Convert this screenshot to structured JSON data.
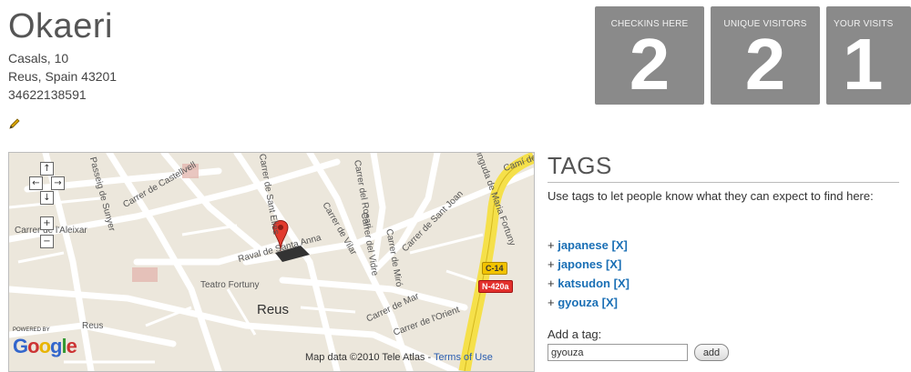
{
  "venue": {
    "name": "Okaeri",
    "address_line1": "Casals, 10",
    "address_line2": "Reus, Spain 43201",
    "phone": "34622138591"
  },
  "stats": [
    {
      "label": "CHECKINS HERE",
      "value": "2"
    },
    {
      "label": "UNIQUE VISITORS",
      "value": "2"
    },
    {
      "label": "YOUR VISITS",
      "value": "1"
    }
  ],
  "map": {
    "city_label": "Reus",
    "street_labels": [
      "Carrer de l'Aleixar",
      "Passeig de Sunyer",
      "Carrer de Castellvell",
      "Carrer del Rosari",
      "Carrer de Sant Elies",
      "Carrer de Sant Joan",
      "Raval de Santa Anna",
      "Carrer de Vilar",
      "Carrer del Vidre",
      "Carrer de l'Orient",
      "Teatro Fortuny",
      "Reus",
      "Carrer de Mar",
      "Carrer de Miró",
      "Avinguda de Maria Fortuny",
      "Camí de"
    ],
    "roads": {
      "c14": "C-14",
      "n420": "N-420a"
    },
    "powered_by": "POWERED BY",
    "google_logo": "Google",
    "attribution": "Map data ©2010 Tele Atlas",
    "terms_link": "Terms of Use",
    "nav": {
      "up": "↑",
      "left": "←",
      "right": "→",
      "down": "↓",
      "zoom_in": "+",
      "zoom_out": "−"
    }
  },
  "tags": {
    "heading": "TAGS",
    "description": "Use tags to let people know what they can expect to find here:",
    "items": [
      "japanese",
      "japones",
      "katsudon",
      "gyouza"
    ],
    "prefix": "+",
    "remove_label": "[X]",
    "add_label": "Add a tag:",
    "input_value": "gyouza",
    "add_button": "add"
  },
  "colors": {
    "stat_bg": "#8a8a8a",
    "link": "#1a6fb5",
    "marker": "#e23b2e",
    "highway": "#f5e04a"
  }
}
